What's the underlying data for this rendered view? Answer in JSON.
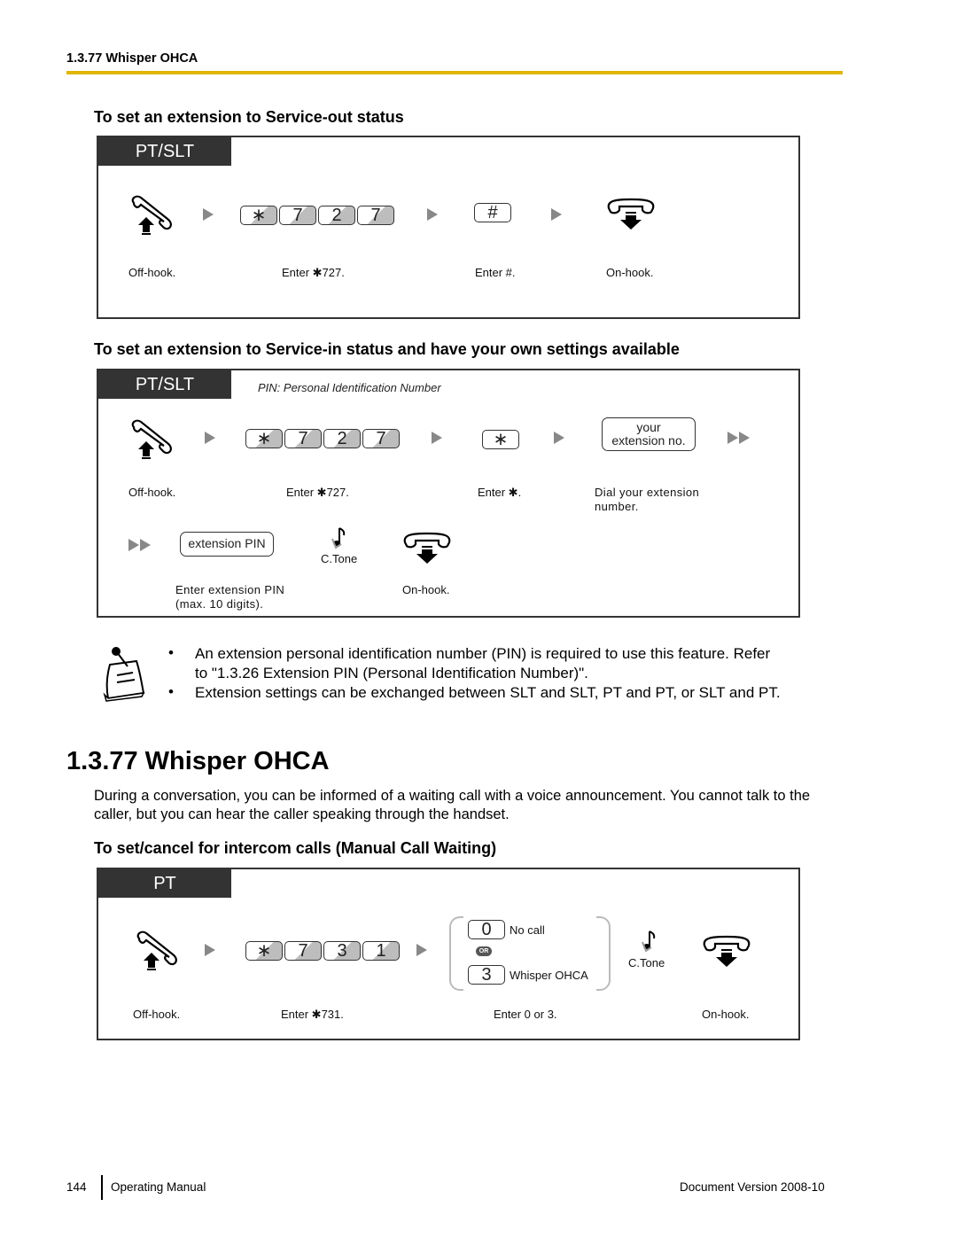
{
  "running_head": "1.3.77 Whisper OHCA",
  "section1": {
    "heading": "To set an extension to Service-out status",
    "tag": "PT/SLT",
    "steps": [
      {
        "icon": "off-hook-icon",
        "caption": "Off-hook."
      },
      {
        "keys": [
          "∗",
          "7",
          "2",
          "7"
        ],
        "caption": "Enter ✱727."
      },
      {
        "keys": [
          "#"
        ],
        "caption": "Enter #."
      },
      {
        "icon": "on-hook-icon",
        "caption": "On-hook."
      }
    ]
  },
  "section2": {
    "heading": "To set an extension to Service-in status and have your own settings available",
    "tag": "PT/SLT",
    "pin_note": "PIN: Personal Identification Number",
    "steps": [
      {
        "icon": "off-hook-icon",
        "caption": "Off-hook."
      },
      {
        "keys": [
          "∗",
          "7",
          "2",
          "7"
        ],
        "caption": "Enter ✱727."
      },
      {
        "keys": [
          "∗"
        ],
        "caption": "Enter ✱."
      },
      {
        "box_line1": "your",
        "box_line2": "extension no.",
        "caption_line1": "Dial your extension",
        "caption_line2": "number."
      },
      {
        "box": "extension PIN",
        "caption_line1": "Enter extension PIN",
        "caption_line2": "(max. 10 digits)."
      },
      {
        "icon": "confirmation-tone-icon",
        "label": "C.Tone"
      },
      {
        "icon": "on-hook-icon",
        "caption": "On-hook."
      }
    ]
  },
  "notes": [
    {
      "line1": "An extension personal identification number (PIN) is required to use this feature. Refer",
      "line2": "to \"1.3.26  Extension PIN (Personal Identification Number)\"."
    },
    {
      "line1": "Extension settings can be exchanged between SLT and SLT, PT and PT, or SLT and PT."
    }
  ],
  "bullet_char": "•",
  "title": "1.3.77  Whisper OHCA",
  "description": "During a conversation, you can be informed of a waiting call with a voice announcement. You cannot talk to the caller, but you can hear the caller speaking through the handset.",
  "section3": {
    "heading": "To set/cancel for intercom calls (Manual Call Waiting)",
    "tag": "PT",
    "steps": [
      {
        "icon": "off-hook-icon",
        "caption": "Off-hook."
      },
      {
        "keys": [
          "∗",
          "7",
          "3",
          "1"
        ],
        "caption": "Enter  ✱731."
      },
      {
        "options": [
          {
            "key": "0",
            "label": "No call"
          },
          {
            "key": "3",
            "label": "Whisper OHCA"
          }
        ],
        "or_label": "OR",
        "caption": "Enter 0 or 3."
      },
      {
        "icon": "confirmation-tone-icon",
        "label": "C.Tone"
      },
      {
        "icon": "on-hook-icon",
        "caption": "On-hook."
      }
    ]
  },
  "footer": {
    "page_number": "144",
    "manual": "Operating Manual",
    "version": "Document Version  2008-10"
  },
  "colors": {
    "gold_rule": "#e0b600",
    "tag_bg": "#333333"
  }
}
